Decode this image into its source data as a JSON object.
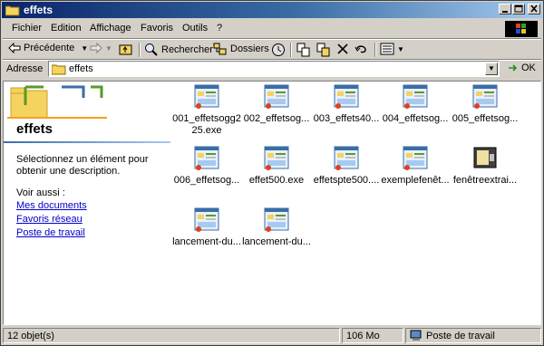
{
  "window": {
    "title": "effets"
  },
  "menu": [
    "Fichier",
    "Edition",
    "Affichage",
    "Favoris",
    "Outils",
    "?"
  ],
  "toolbar": {
    "back_label": "Précédente",
    "search_label": "Rechercher",
    "folders_label": "Dossiers"
  },
  "address": {
    "label": "Adresse",
    "value": "effets",
    "go_label": "OK"
  },
  "left_pane": {
    "title": "effets",
    "description": "Sélectionnez un élément pour obtenir une description.",
    "see_also": "Voir aussi :",
    "links": [
      "Mes documents",
      "Favoris réseau",
      "Poste de travail"
    ]
  },
  "files": [
    {
      "line1": "001_effetsogg2",
      "line2": "25.exe",
      "icon": "exe-app-icon"
    },
    {
      "line1": "002_effetsog...",
      "line2": "",
      "icon": "exe-app-icon"
    },
    {
      "line1": "003_effets40...",
      "line2": "",
      "icon": "exe-app-icon"
    },
    {
      "line1": "004_effetsog...",
      "line2": "",
      "icon": "exe-app-icon"
    },
    {
      "line1": "005_effetsog...",
      "line2": "",
      "icon": "exe-app-icon"
    },
    {
      "line1": "006_effetsog...",
      "line2": "",
      "icon": "exe-app-icon"
    },
    {
      "line1": "effet500.exe",
      "line2": "",
      "icon": "exe-app-icon"
    },
    {
      "line1": "effetspte500....",
      "line2": "",
      "icon": "exe-app-icon"
    },
    {
      "line1": "exemplefenêt...",
      "line2": "",
      "icon": "exe-app-icon"
    },
    {
      "line1": "fenêtreextrai...",
      "line2": "",
      "icon": "dark-app-icon"
    },
    {
      "line1": "lancement-du...",
      "line2": "",
      "icon": "exe-app-icon"
    },
    {
      "line1": "lancement-du...",
      "line2": "",
      "icon": "exe-app-icon"
    }
  ],
  "status": {
    "count": "12 objet(s)",
    "size": "106 Mo",
    "location": "Poste de travail"
  }
}
